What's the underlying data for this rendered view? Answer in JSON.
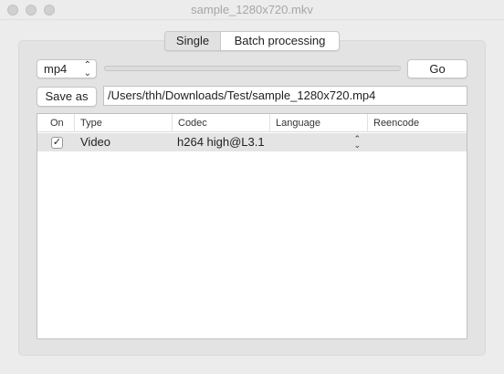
{
  "window": {
    "title": "sample_1280x720.mkv"
  },
  "tabs": [
    {
      "label": "Single",
      "active": true
    },
    {
      "label": "Batch processing",
      "active": false
    }
  ],
  "toolbar": {
    "format_value": "mp4",
    "progress": 0,
    "go_label": "Go",
    "save_as_label": "Save as",
    "output_path": "/Users/thh/Downloads/Test/sample_1280x720.mp4"
  },
  "table": {
    "columns": [
      "On",
      "Type",
      "Codec",
      "Language",
      "Reencode"
    ],
    "rows": [
      {
        "on": true,
        "on_mark": "✓",
        "type": "Video",
        "codec": "h264 high@L3.1",
        "language": ""
      }
    ]
  },
  "icons": {
    "checkmark": "checkmark-icon",
    "popup_chevrons": "updown-chevron-icon"
  },
  "colors": {
    "window_bg": "#ececec",
    "panel_bg": "#e3e3e3",
    "row_selected": "#e4e4e4",
    "title_text": "#a6a6a6"
  }
}
